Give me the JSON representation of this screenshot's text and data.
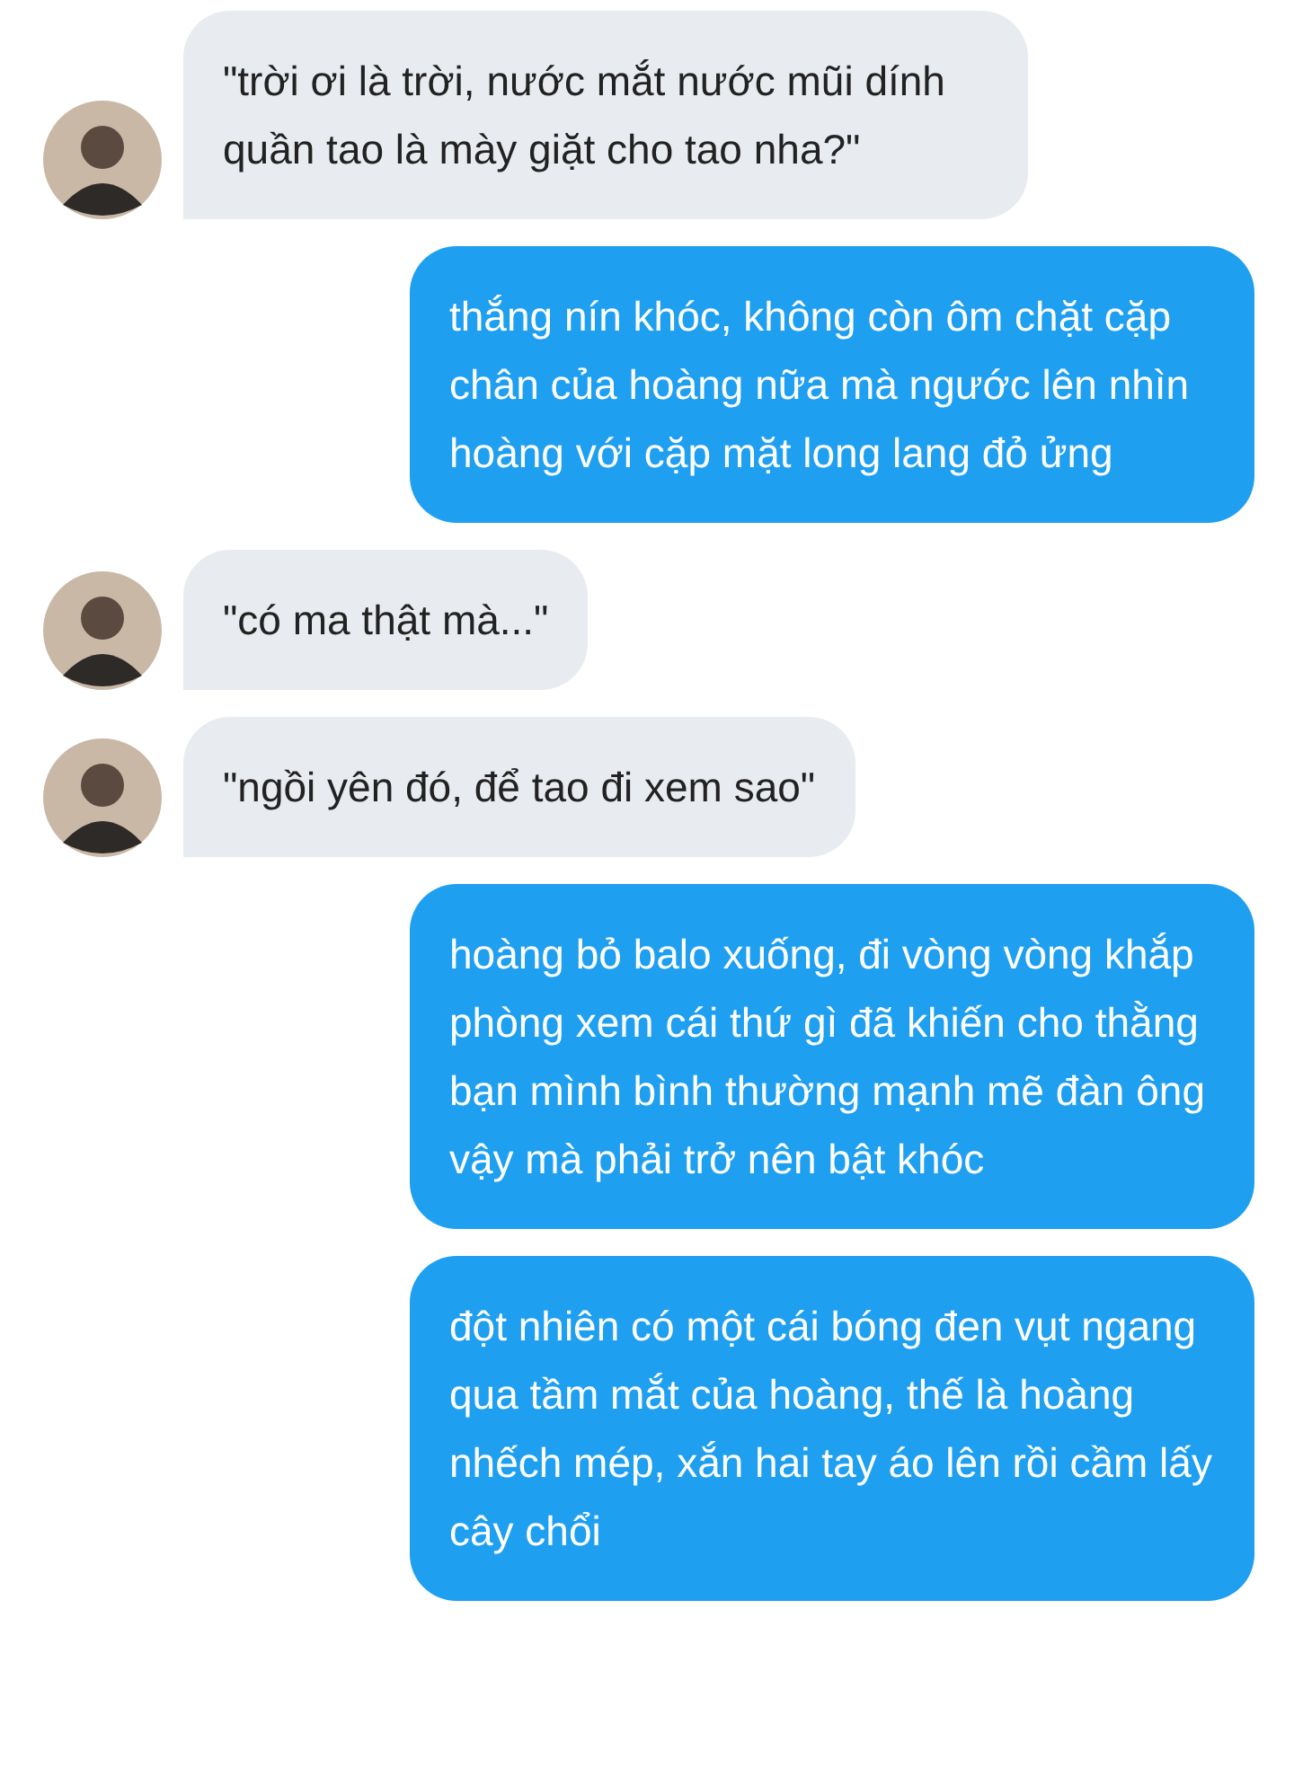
{
  "messages": [
    {
      "kind": "received",
      "avatar": true,
      "text": "\"trời ơi là trời, nước mắt nước mũi dính quần tao là mày giặt cho tao nha?\""
    },
    {
      "kind": "sent",
      "text": "thắng nín khóc, không còn ôm chặt cặp chân của hoàng nữa mà ngước lên nhìn hoàng với cặp mặt long lang đỏ ửng"
    },
    {
      "kind": "received",
      "avatar": true,
      "text": "\"có ma thật mà...\""
    },
    {
      "kind": "received",
      "avatar": true,
      "text": "\"ngồi yên đó, để tao đi xem sao\""
    },
    {
      "kind": "sent",
      "text": "hoàng bỏ balo xuống, đi vòng vòng khắp phòng xem cái thứ gì đã khiến cho thằng bạn mình bình thường mạnh mẽ đàn ông vậy mà phải trở nên bật khóc"
    },
    {
      "kind": "sent",
      "text": "đột nhiên có một cái bóng đen vụt ngang qua tầm mắt của hoàng, thế là hoàng nhếch mép, xắn hai tay áo lên rồi cầm lấy cây chổi"
    }
  ]
}
